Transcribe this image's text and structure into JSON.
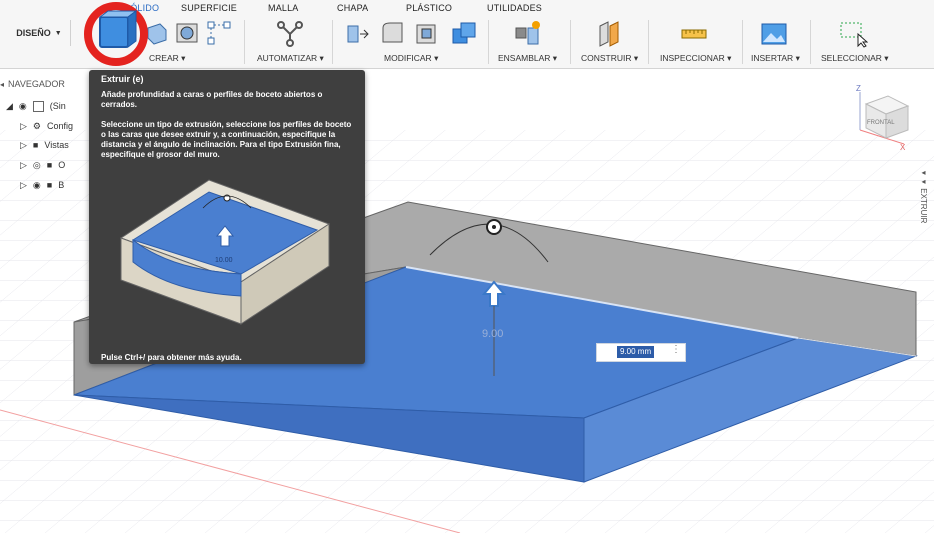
{
  "toolbar": {
    "design_label": "DISEÑO",
    "tabs": [
      "SÓLIDO",
      "SUPERFICIE",
      "MALLA",
      "CHAPA",
      "PLÁSTICO",
      "UTILIDADES"
    ],
    "groups": {
      "crear": "CREAR",
      "automatizar": "AUTOMATIZAR",
      "modificar": "MODIFICAR",
      "ensamblar": "ENSAMBLAR",
      "construir": "CONSTRUIR",
      "inspeccionar": "INSPECCIONAR",
      "insertar": "INSERTAR",
      "seleccionar": "SELECCIONAR"
    }
  },
  "browser": {
    "header": "NAVEGADOR",
    "items": [
      {
        "label": "(Sin"
      },
      {
        "label": "Config"
      },
      {
        "label": "Vistas"
      },
      {
        "label": "O"
      },
      {
        "label": "B"
      }
    ]
  },
  "tooltip": {
    "title": "Extruir (e)",
    "paragraph1": "Añade profundidad a caras o perfiles de boceto abiertos o cerrados.",
    "paragraph2": "Seleccione un tipo de extrusión, seleccione los perfiles de boceto o las caras que desee extruir y, a continuación, especifique la distancia y el ángulo de inclinación. Para el tipo Extrusión fina, especifique el grosor del muro.",
    "illustration_label": "10.00",
    "footer": "Pulse Ctrl+/ para obtener más ayuda."
  },
  "canvas": {
    "dimension_label": "9.00",
    "dimension_input": "9.00 mm",
    "viewcube_label": "FRONTAL",
    "axis_z": "Z",
    "axis_x": "X",
    "side_panel_label": "EXTRUIR"
  },
  "colors": {
    "accent_blue": "#3f75c9",
    "highlight_red": "#e4231f",
    "tooltip_bg": "#3f3f3f"
  }
}
